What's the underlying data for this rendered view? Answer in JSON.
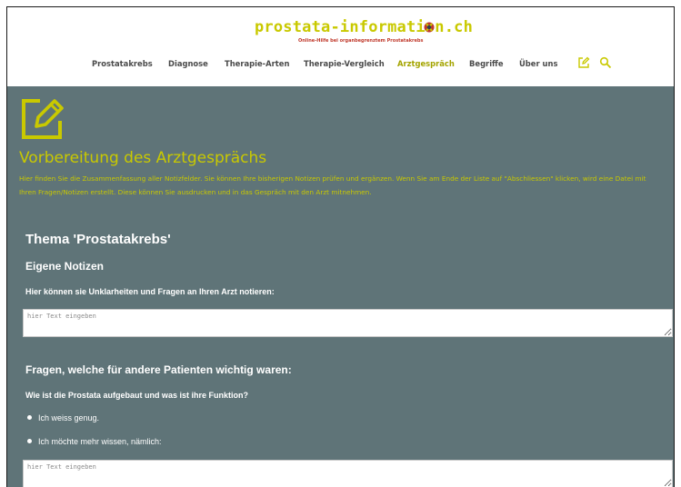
{
  "header": {
    "logo_text": "prostata-information.ch",
    "logo_tagline": "Online-Hilfe bei organbegrenztem Prostatakrebs",
    "nav": [
      {
        "label": "Prostatakrebs",
        "active": false
      },
      {
        "label": "Diagnose",
        "active": false
      },
      {
        "label": "Therapie-Arten",
        "active": false
      },
      {
        "label": "Therapie-Vergleich",
        "active": false
      },
      {
        "label": "Arztgespräch",
        "active": true
      },
      {
        "label": "Begriffe",
        "active": false
      },
      {
        "label": "Über uns",
        "active": false
      }
    ],
    "icons": [
      "edit-icon",
      "search-icon"
    ]
  },
  "main": {
    "title": "Vorbereitung des Arztgesprächs",
    "intro": "Hier finden Sie die Zusammenfassung aller Notizfelder. Sie können Ihre bisherigen Notizen prüfen und ergänzen. Wenn Sie am Ende der Liste auf \"Abschliessen\" klicken, wird eine Datei mit Ihren Fragen/Notizen erstellt. Diese können Sie ausdrucken und in das Gespräch mit den Arzt mitnehmen.",
    "theme_heading": "Thema 'Prostatakrebs'",
    "notes_heading": "Eigene Notizen",
    "notes_label": "Hier können sie Unklarheiten und Fragen an Ihren Arzt notieren:",
    "notes_placeholder": "hier Text eingeben",
    "questions_heading": "Fragen, welche für andere Patienten wichtig waren:",
    "question_1": "Wie ist die Prostata aufgebaut und was ist ihre Funktion?",
    "options": [
      "Ich weiss genug.",
      "Ich möchte mehr wissen, nämlich:"
    ],
    "answer_placeholder": "hier Text eingeben"
  },
  "colors": {
    "accent": "#c9c900",
    "accent_active": "#a4a400",
    "content_bg": "#5f7478",
    "nav_text": "#4a4a4a"
  }
}
